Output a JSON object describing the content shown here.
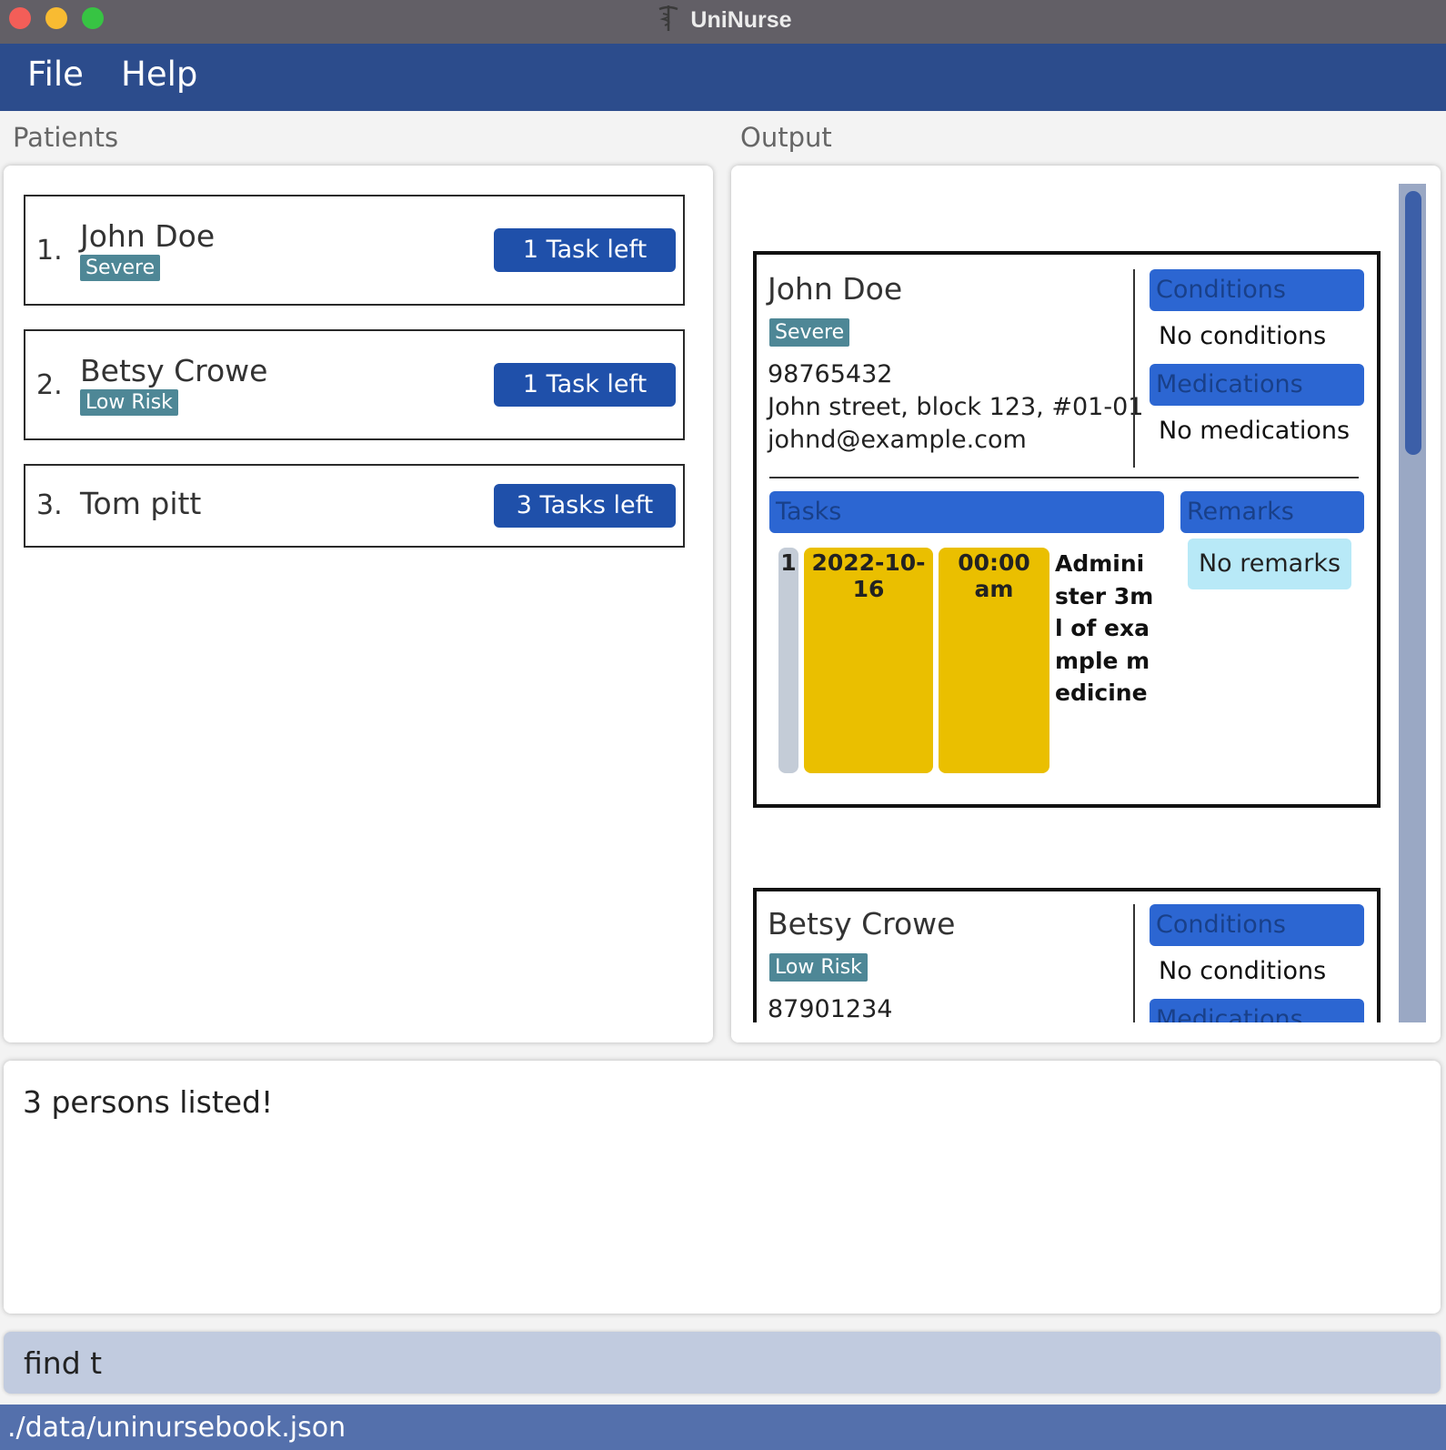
{
  "window": {
    "title": "UniNurse"
  },
  "menu": {
    "file": "File",
    "help": "Help"
  },
  "labels": {
    "patients": "Patients",
    "output": "Output"
  },
  "patients": [
    {
      "index": "1.",
      "name": "John Doe",
      "tag": "Severe",
      "tasks": "1 Task left"
    },
    {
      "index": "2.",
      "name": "Betsy Crowe",
      "tag": "Low Risk",
      "tasks": "1 Task left"
    },
    {
      "index": "3.",
      "name": "Tom pitt",
      "tag": "",
      "tasks": "3 Tasks left"
    }
  ],
  "output": {
    "patient1": {
      "name": "John Doe",
      "tag": "Severe",
      "phone": "98765432",
      "address": "John street, block 123, #01-01",
      "email": "johnd@example.com",
      "conditions_header": "Conditions",
      "conditions": "No conditions",
      "medications_header": "Medications",
      "medications": "No medications",
      "tasks_header": "Tasks",
      "remarks_header": "Remarks",
      "remarks": "No remarks",
      "task": {
        "index": "1",
        "date": "2022-10-16",
        "time": "00:00 am",
        "description": "Administer 3ml of example medicine"
      }
    },
    "patient2": {
      "name": "Betsy Crowe",
      "tag": "Low Risk",
      "phone": "87901234",
      "conditions_header": "Conditions",
      "conditions": "No conditions",
      "medications_header": "Medications"
    }
  },
  "result": {
    "message": "3 persons listed!"
  },
  "command": {
    "value": "find t"
  },
  "status": {
    "path": "./data/uninursebook.json"
  }
}
